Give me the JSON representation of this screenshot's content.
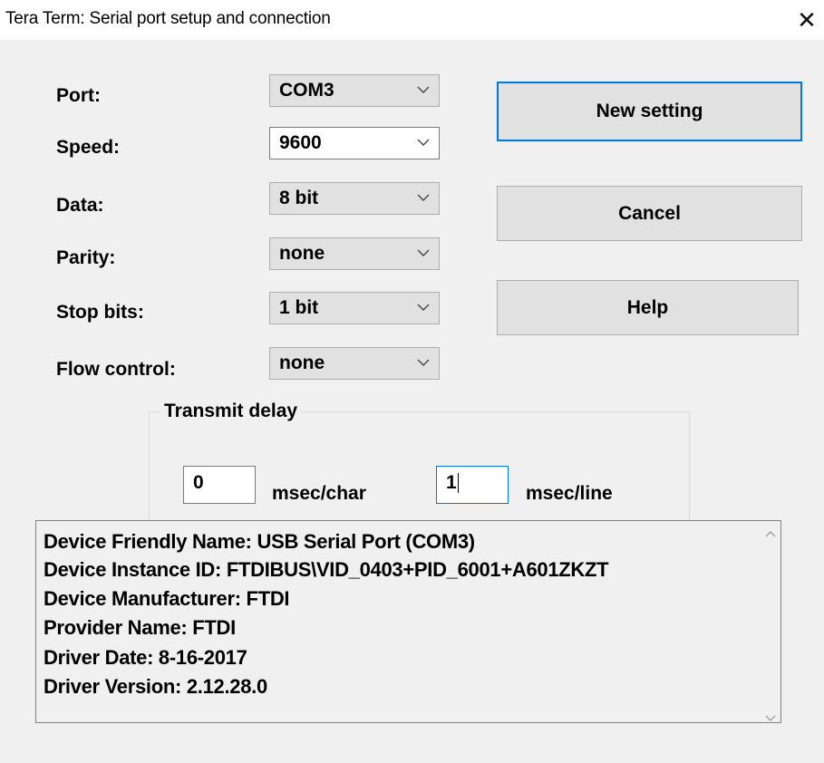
{
  "window": {
    "title": "Tera Term: Serial port setup and connection"
  },
  "settings": [
    {
      "label": "Port:",
      "value": "COM3"
    },
    {
      "label": "Speed:",
      "value": "9600"
    },
    {
      "label": "Data:",
      "value": "8 bit"
    },
    {
      "label": "Parity:",
      "value": "none"
    },
    {
      "label": "Stop bits:",
      "value": "1 bit"
    },
    {
      "label": "Flow control:",
      "value": "none"
    }
  ],
  "buttons": {
    "new_setting": "New setting",
    "cancel": "Cancel",
    "help": "Help"
  },
  "transmit_delay": {
    "legend": "Transmit delay",
    "char_value": "0",
    "char_unit": "msec/char",
    "line_value": "1",
    "line_unit": "msec/line"
  },
  "device_info": [
    "Device Friendly Name: USB Serial Port (COM3)",
    "Device Instance ID: FTDIBUS\\VID_0403+PID_6001+A601ZKZT",
    "Device Manufacturer: FTDI",
    "Provider Name: FTDI",
    "Driver Date: 8-16-2017",
    "Driver Version: 2.12.28.0"
  ],
  "icons": {
    "close": "close-icon",
    "dropdown": "chevron-down-icon",
    "scroll_up": "scroll-up-arrow-icon",
    "scroll_down": "scroll-down-arrow-icon"
  },
  "colors": {
    "focus_accent": "#0078d7",
    "dialog_background": "#f0f0f0",
    "button_face": "#e1e1e1"
  }
}
